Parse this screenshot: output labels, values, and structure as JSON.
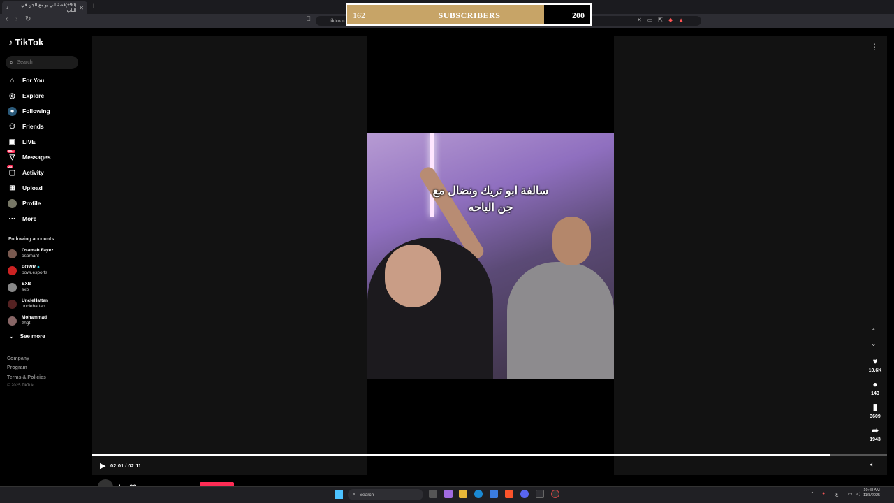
{
  "browser": {
    "tab_title": "(90+)قصة ابي يو مع الجن في الباب",
    "url": "tiktok.c"
  },
  "overlay": {
    "current": "162",
    "label": "SUBSCRIBERS",
    "goal": "200",
    "progress_fraction": 0.81,
    "fill_color": "#c7a467"
  },
  "tiktok": {
    "logo": "TikTok",
    "search_placeholder": "Search",
    "nav": [
      {
        "label": "For You",
        "icon": "home-icon"
      },
      {
        "label": "Explore",
        "icon": "compass-icon"
      },
      {
        "label": "Following",
        "icon": "following-avatar-icon"
      },
      {
        "label": "Friends",
        "icon": "friends-icon"
      },
      {
        "label": "LIVE",
        "icon": "live-icon"
      },
      {
        "label": "Messages",
        "icon": "messages-icon",
        "badge": "99+"
      },
      {
        "label": "Activity",
        "icon": "activity-icon",
        "badge": "23"
      },
      {
        "label": "Upload",
        "icon": "upload-icon"
      },
      {
        "label": "Profile",
        "icon": "profile-icon"
      },
      {
        "label": "More",
        "icon": "more-icon"
      }
    ],
    "following_title": "Following accounts",
    "accounts": [
      {
        "name": "Osamah Fayez",
        "handle": "osamahf"
      },
      {
        "name": "POWR",
        "handle": "powr.esports",
        "verified": true
      },
      {
        "name": "SXB",
        "handle": "sxb"
      },
      {
        "name": "UncleHattan",
        "handle": "unclehattan"
      },
      {
        "name": "Mohammad",
        "handle": "zhgt"
      }
    ],
    "see_more": "See more",
    "footer": [
      "Company",
      "Program",
      "Terms & Policies"
    ],
    "copyright": "© 2025 TikTok"
  },
  "video": {
    "caption_line1": "سالفة ابو تريك ونضال مع",
    "caption_line2": "جن الباحه",
    "likes": "10.6K",
    "comments": "143",
    "saves": "3609",
    "shares": "1943",
    "time": "02:01 / 02:11",
    "progress_fraction": 0.929,
    "author": "hsx98s"
  },
  "taskbar": {
    "search": "Search",
    "time": "10:48 AM",
    "date": "11/8/2025",
    "lang": "ع"
  }
}
